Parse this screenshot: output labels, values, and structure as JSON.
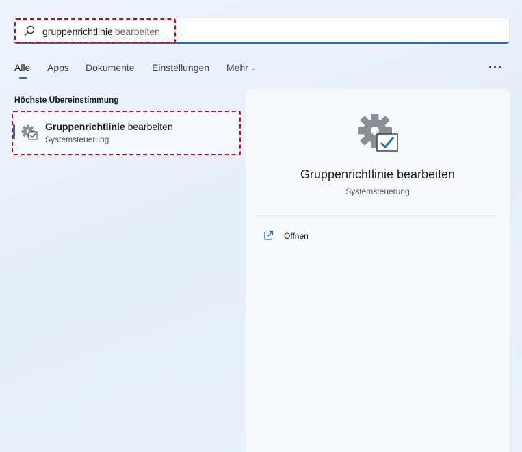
{
  "search": {
    "typed": "gruppenrichtlinie",
    "suggestion": "bearbeiten"
  },
  "tabs": [
    {
      "label": "Alle",
      "active": true
    },
    {
      "label": "Apps",
      "active": false
    },
    {
      "label": "Dokumente",
      "active": false
    },
    {
      "label": "Einstellungen",
      "active": false
    },
    {
      "label": "Mehr",
      "active": false
    }
  ],
  "more_menu": "···",
  "best_match": {
    "heading": "Höchste Übereinstimmung",
    "title_bold": "Gruppenrichtlinie",
    "title_rest": "bearbeiten",
    "subtitle": "Systemsteuerung",
    "icon": "gear-check-icon"
  },
  "detail": {
    "title": "Gruppenrichtlinie bearbeiten",
    "subtitle": "Systemsteuerung",
    "actions": [
      {
        "label": "Öffnen",
        "icon": "open-external-icon"
      }
    ]
  },
  "colors": {
    "accent": "#1f6fb8",
    "highlight": "#d0021b"
  }
}
